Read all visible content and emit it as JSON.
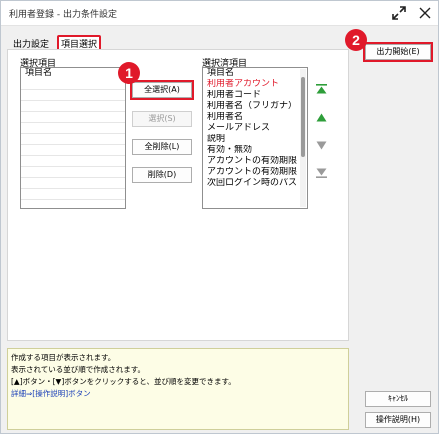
{
  "window": {
    "title": "利用者登録 - 出力条件設定"
  },
  "titlebar": {
    "expand_icon": "expand-icon",
    "close_icon": "close-icon"
  },
  "tabs": [
    {
      "label": "出力設定",
      "active": false
    },
    {
      "label": "項目選択",
      "active": true
    }
  ],
  "left_list": {
    "label": "選択項目",
    "header": "項目名"
  },
  "middle_buttons": {
    "select_all": "全選択(A)",
    "select": "選択(S)",
    "remove_all": "全削除(L)",
    "remove": "削除(D)"
  },
  "right_list": {
    "label": "選択済項目",
    "header": "項目名",
    "items": [
      {
        "text": "利用者アカウント",
        "color": "#e0192a"
      },
      {
        "text": "利用者コード"
      },
      {
        "text": "利用者名（フリガナ）"
      },
      {
        "text": "利用者名"
      },
      {
        "text": "メールアドレス"
      },
      {
        "text": "説明"
      },
      {
        "text": "有効・無効"
      },
      {
        "text": "アカウントの有効期限"
      },
      {
        "text": "アカウントの有効期限"
      },
      {
        "text": "次回ログイン時のパス"
      }
    ]
  },
  "move_buttons": [
    "move-top-icon",
    "move-up-icon",
    "move-down-icon",
    "move-bottom-icon"
  ],
  "output_start": "出力開始(E)",
  "cancel": "ｷｬﾝｾﾙ",
  "help": "操作説明(H)",
  "info": {
    "line1": "作成する項目が表示されます。",
    "line2": "表示されている並び順で作成されます。",
    "line3": "[▲]ボタン・[▼]ボタンをクリックすると、並び順を変更できます。",
    "line4": "詳細⇒[操作説明]ボタン"
  },
  "annotations": {
    "badge1": "1",
    "badge2": "2"
  },
  "colors": {
    "accent_red": "#e0192a",
    "move_green": "#2e9e3a"
  }
}
